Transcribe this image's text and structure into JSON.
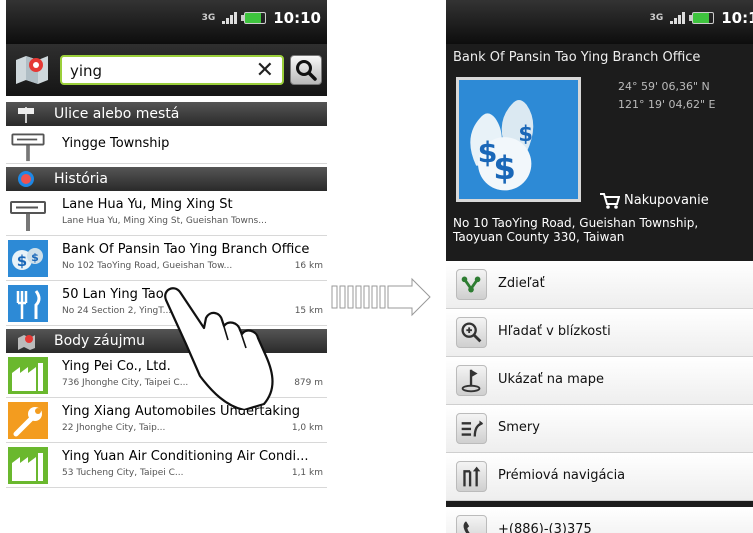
{
  "status": {
    "network": "3G",
    "time": "10:10"
  },
  "left": {
    "search": {
      "value": "ying"
    },
    "sections": {
      "streets": "Ulice alebo mestá",
      "history": "História",
      "poi": "Body záujmu"
    },
    "streets": [
      {
        "title": "Yingge  Township",
        "icon": "road-sign-icon"
      }
    ],
    "history": [
      {
        "title": "Lane Hua Yu, Ming Xing St",
        "sub": "Lane Hua Yu, Ming Xing St, Gueishan  Towns...",
        "dist": "",
        "icon": "road-sign-icon"
      },
      {
        "title": "Bank Of Pansin Tao Ying Branch Office",
        "sub": "No 102 TaoYing Road, Gueishan  Tow...",
        "dist": "16 km",
        "icon": "money-bags-icon"
      },
      {
        "title": "50 Lan Ying Tao",
        "sub": "No 24 Section 2, YingT...",
        "dist": "15 km",
        "icon": "fork-knife-icon"
      }
    ],
    "poi": [
      {
        "title": "Ying Pei Co., Ltd.",
        "sub": "736 Jhonghe  City, Taipei C...",
        "dist": "879 m",
        "icon": "factory-icon"
      },
      {
        "title": "Ying Xiang Automobiles Undertaking",
        "sub": "22 Jhonghe  City, Taip...",
        "dist": "1,0 km",
        "icon": "wrench-icon"
      },
      {
        "title": "Ying Yuan Air Conditioning Air Condi...",
        "sub": "53 Tucheng  City, Taipei C...",
        "dist": "1,1 km",
        "icon": "factory-icon"
      }
    ]
  },
  "right": {
    "title": "Bank Of Pansin Tao Ying Branch Office",
    "lat": "24° 59' 06,36\" N",
    "lon": "121° 19' 04,62\" E",
    "category": "Nakupovanie",
    "address_line1": "No 10  TaoYing Road, Gueishan  Township,",
    "address_line2": "Taoyuan County 330, Taiwan",
    "actions": [
      {
        "label": "Zdieľať",
        "icon": "share-icon"
      },
      {
        "label": "Hľadať v blízkosti",
        "icon": "search-nearby-icon"
      },
      {
        "label": "Ukázať na mape",
        "icon": "map-pin-icon"
      },
      {
        "label": "Smery",
        "icon": "directions-icon"
      },
      {
        "label": "Prémiová navigácia",
        "icon": "navigation-icon"
      }
    ],
    "phone": "+(886)-(3)375"
  },
  "colors": {
    "accent": "#9bcf3a",
    "dark": "#1c1c1c"
  }
}
